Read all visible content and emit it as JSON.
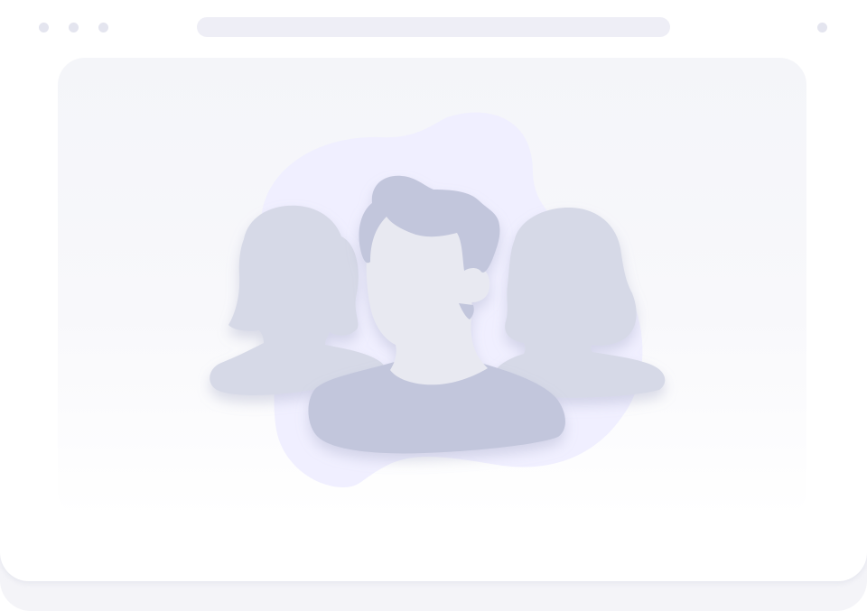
{
  "window": {
    "controls": [
      "dot",
      "dot",
      "dot"
    ],
    "address_bar": ""
  },
  "illustration": {
    "subject": "users-group",
    "colors": {
      "blob": "#f0efff",
      "main_figure": "#c2c6dc",
      "face": "#e8e9f1",
      "side_figures": "#d6d9e7",
      "panel": "#f5f6fa",
      "chrome": "#e4e5ef"
    }
  }
}
